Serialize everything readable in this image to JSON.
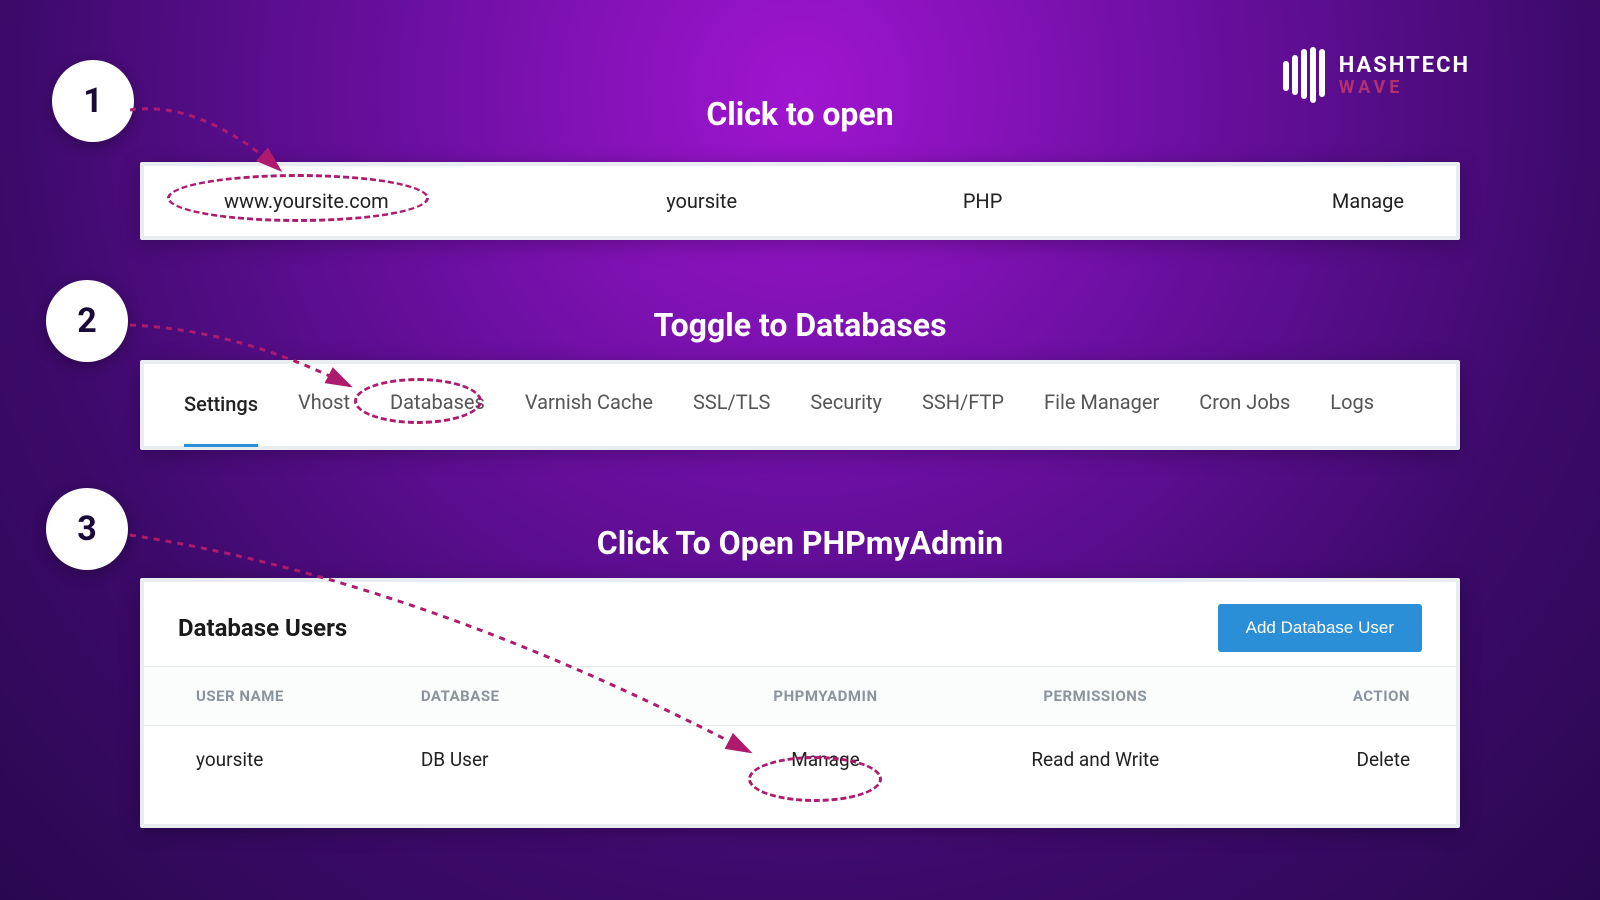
{
  "logo": {
    "line1": "HASHTECH",
    "line2": "WAVE"
  },
  "steps": {
    "s1": {
      "num": "1",
      "heading": "Click to open"
    },
    "s2": {
      "num": "2",
      "heading": "Toggle to Databases"
    },
    "s3": {
      "num": "3",
      "heading": "Click To Open PHPmyAdmin"
    }
  },
  "panel1": {
    "domain": "www.yoursite.com",
    "app": "yoursite",
    "tech": "PHP",
    "action": "Manage"
  },
  "tabs": {
    "settings": "Settings",
    "vhost": "Vhost",
    "databases": "Databases",
    "varnish": "Varnish Cache",
    "ssl": "SSL/TLS",
    "security": "Security",
    "ssh": "SSH/FTP",
    "filemgr": "File Manager",
    "cron": "Cron Jobs",
    "logs": "Logs"
  },
  "panel3": {
    "title": "Database Users",
    "add_btn": "Add Database User",
    "headers": {
      "user": "USER NAME",
      "db": "DATABASE",
      "pma": "PHPMYADMIN",
      "perm": "PERMISSIONS",
      "action": "ACTION"
    },
    "row": {
      "user": "yoursite",
      "db": "DB User",
      "pma": "Manage",
      "perm": "Read and Write",
      "action": "Delete"
    }
  }
}
